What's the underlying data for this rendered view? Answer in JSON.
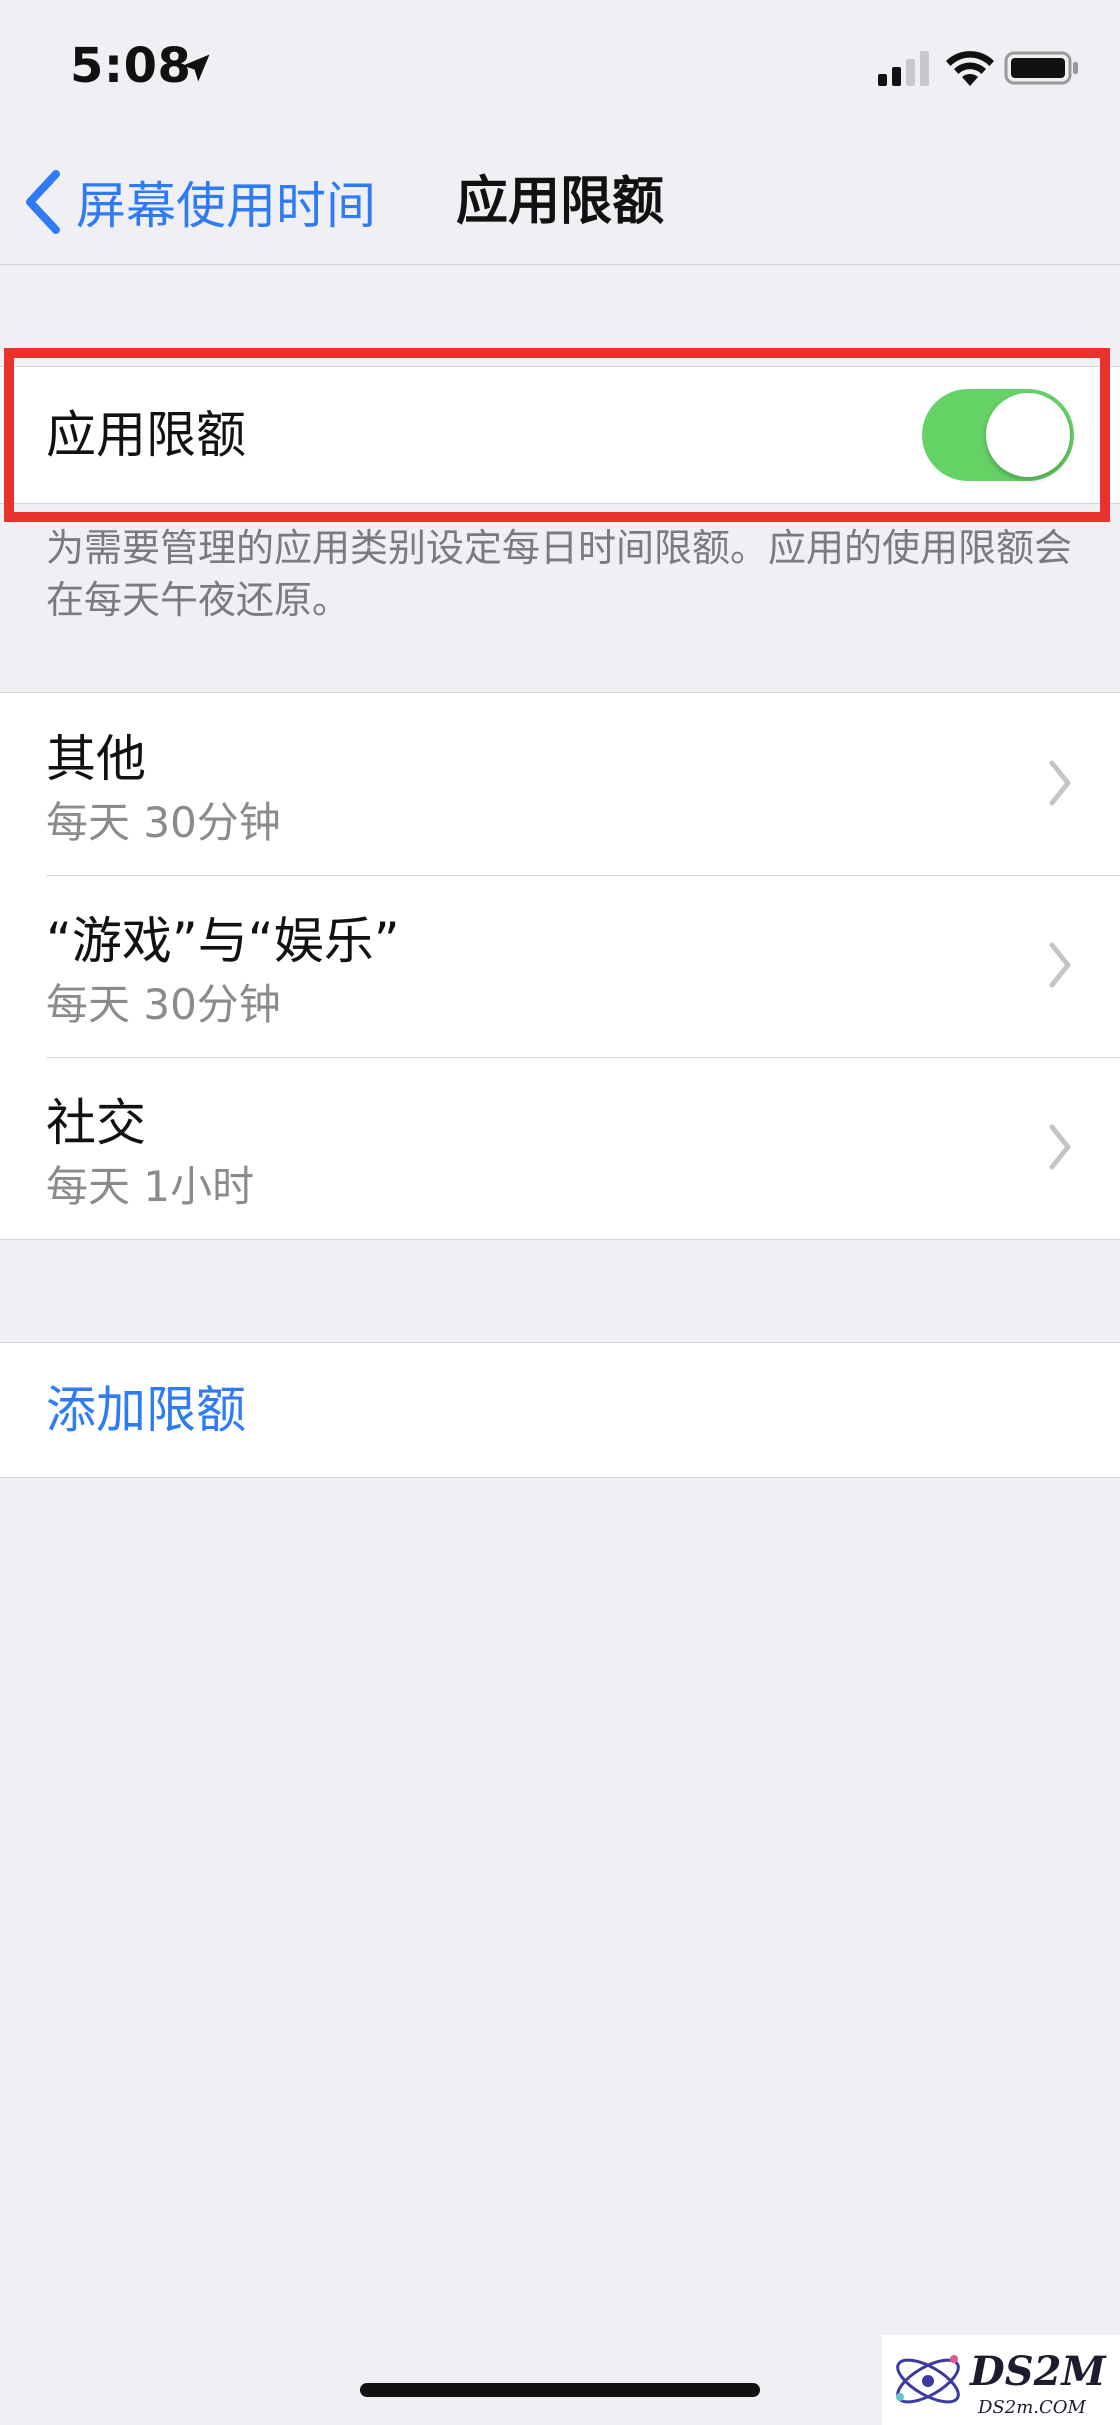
{
  "status_bar": {
    "time": "5:08",
    "location_icon": "location-arrow-icon",
    "signal_icon": "cellular-signal-icon",
    "wifi_icon": "wifi-icon",
    "battery_icon": "battery-icon"
  },
  "nav": {
    "back_label": "屏幕使用时间",
    "title": "应用限额"
  },
  "toggle": {
    "label": "应用限额",
    "on": true
  },
  "footer_note": "为需要管理的应用类别设定每日时间限额。应用的使用限额会在每天午夜还原。",
  "limits": [
    {
      "title": "其他",
      "detail": "每天 30分钟"
    },
    {
      "title": "“游戏”与“娱乐”",
      "detail": "每天 30分钟"
    },
    {
      "title": "社交",
      "detail": "每天 1小时"
    }
  ],
  "add_limit_label": "添加限额",
  "watermark": {
    "logo_text": "DS2M",
    "url_text": "DS2m.COM"
  },
  "colors": {
    "accent": "#2f7bf5",
    "switch_on": "#65d266",
    "highlight": "#e8322b",
    "background": "#efeff4"
  }
}
